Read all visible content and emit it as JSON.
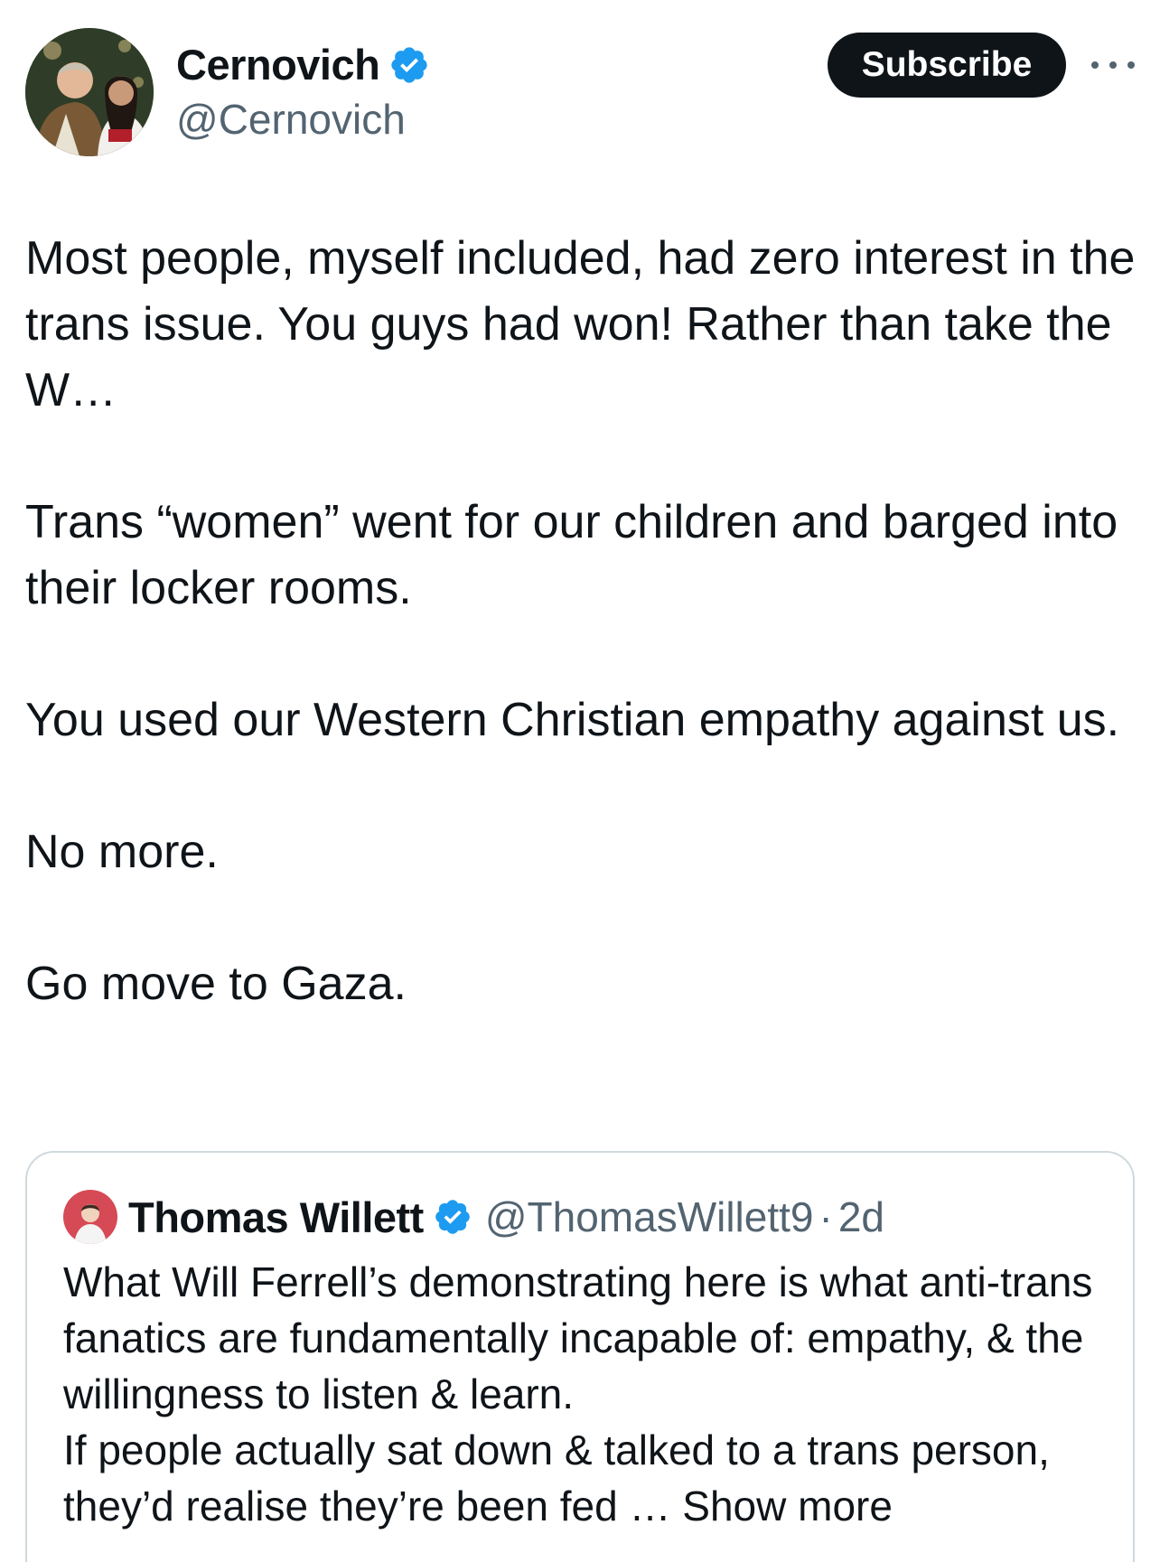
{
  "author": {
    "display_name": "Cernovich",
    "handle": "@Cernovich",
    "verified": true,
    "verified_color": "#1d9bf0"
  },
  "header": {
    "subscribe_label": "Subscribe",
    "more_icon": "more-horizontal-icon"
  },
  "tweet": {
    "paragraphs": [
      "Most people, myself included, had zero interest in the trans issue. You guys had won! Rather than take the W…",
      "Trans “women” went for our children and barged into their locker rooms.",
      "You used our Western Christian empathy against us.",
      "No more.",
      "Go move to Gaza."
    ]
  },
  "quote": {
    "display_name": "Thomas Willett",
    "handle": "@ThomasWillett9",
    "separator": "·",
    "time": "2d",
    "verified": true,
    "text": "What Will Ferrell’s demonstrating here is what anti-trans fanatics are fundamentally incapable of: empathy, & the willingness to listen & learn.\nIf people actually sat down & talked to a trans person, they’d realise they’re been fed …",
    "show_more_label": "Show more"
  },
  "colors": {
    "text_primary": "#0f1419",
    "text_secondary": "#536471",
    "border": "#cfd9de",
    "button_bg": "#0f1419"
  }
}
